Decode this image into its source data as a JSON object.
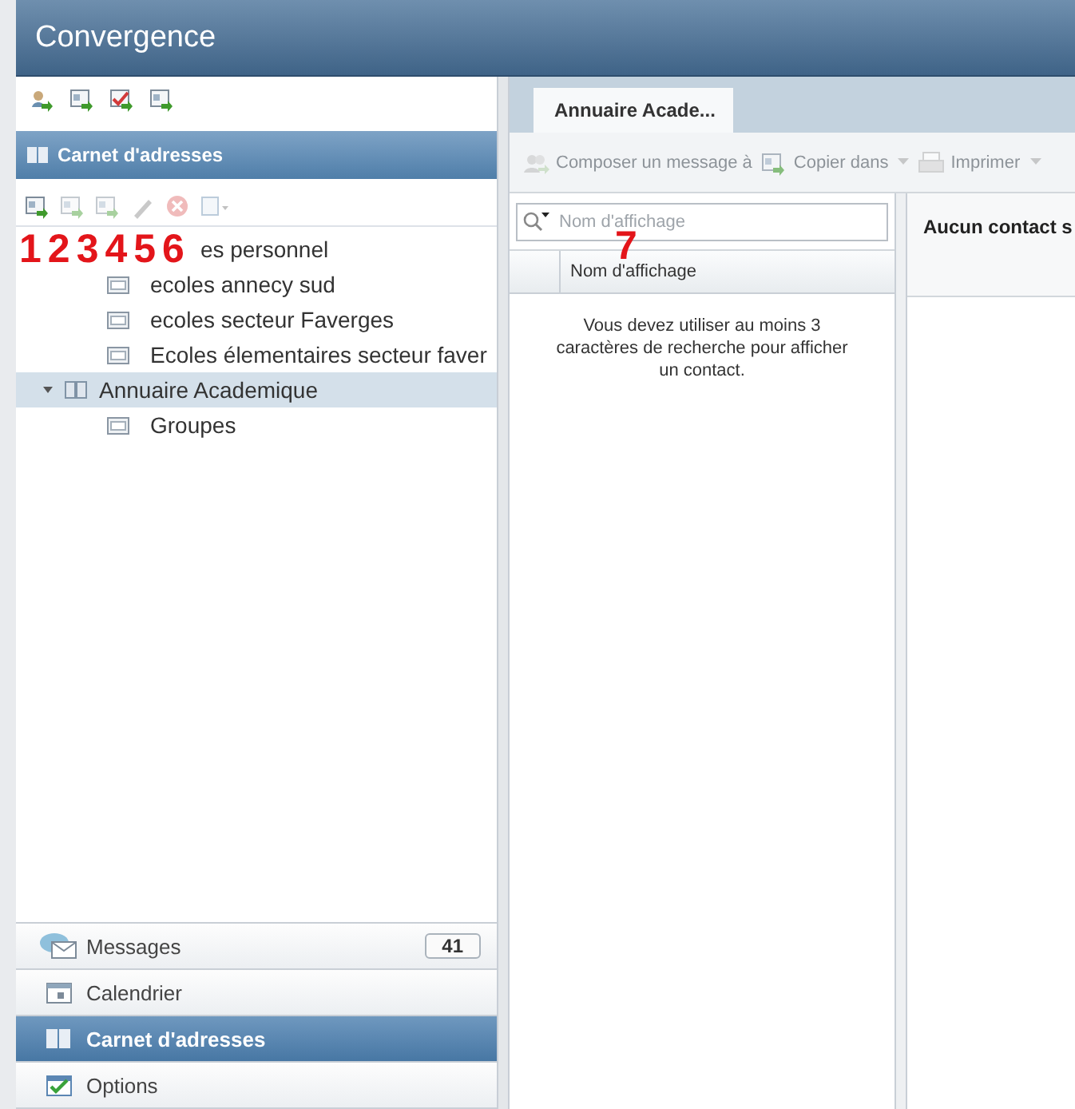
{
  "app": {
    "title": "Convergence"
  },
  "sidebar": {
    "header": "Carnet d'adresses",
    "tree_toolbar": [
      {
        "kind": "add",
        "disabled": false
      },
      {
        "kind": "add",
        "disabled": true
      },
      {
        "kind": "add",
        "disabled": true
      },
      {
        "kind": "edit",
        "disabled": true
      },
      {
        "kind": "delete",
        "disabled": true
      },
      {
        "kind": "menu",
        "disabled": true
      }
    ],
    "tree": [
      {
        "label": "es personnel",
        "marks": [
          "1",
          "2",
          "3",
          "4",
          "5",
          "6"
        ],
        "selected": false,
        "children": [
          {
            "label": "ecoles annecy sud",
            "selected": false
          },
          {
            "label": "ecoles secteur Faverges",
            "selected": false
          },
          {
            "label": "Ecoles élementaires secteur faver",
            "selected": false
          }
        ]
      },
      {
        "label": "Annuaire Academique",
        "expanded": true,
        "selected": true,
        "children": [
          {
            "label": "Groupes",
            "selected": false
          }
        ]
      }
    ],
    "nav": [
      {
        "kind": "mail",
        "label": "Messages",
        "badge": "41",
        "selected": false
      },
      {
        "kind": "calendar",
        "label": "Calendrier",
        "selected": false
      },
      {
        "kind": "book",
        "label": "Carnet d'adresses",
        "selected": true
      },
      {
        "kind": "options",
        "label": "Options",
        "selected": false
      }
    ]
  },
  "tabs": [
    {
      "label": "Annuaire Acade...",
      "selected": true
    }
  ],
  "toolbar": [
    {
      "label": "Composer un message à",
      "dropdown": false,
      "disabled": true
    },
    {
      "label": "Copier dans",
      "dropdown": true,
      "disabled": true
    },
    {
      "label": "Imprimer",
      "dropdown": true,
      "disabled": true
    }
  ],
  "search": {
    "placeholder": "Nom d'affichage"
  },
  "list": {
    "columns": [
      {
        "label": "Nom d'affichage"
      }
    ],
    "empty_message": "Vous devez utiliser au moins 3 caractères de recherche pour afficher un contact."
  },
  "detail": {
    "title": "Aucun contact s"
  },
  "annotations": {
    "marker": "7"
  }
}
